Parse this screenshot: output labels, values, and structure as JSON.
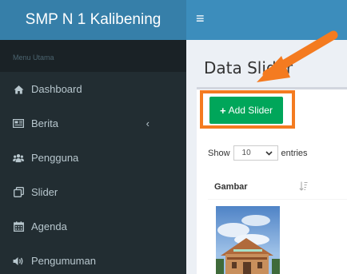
{
  "header": {
    "brand": "SMP N 1 Kalibening",
    "menu_icon": "≡"
  },
  "sidebar": {
    "section_label": "Menu Utama",
    "items": [
      {
        "label": "Dashboard",
        "icon": "home-icon"
      },
      {
        "label": "Berita",
        "icon": "newspaper-icon",
        "chevron": "‹"
      },
      {
        "label": "Pengguna",
        "icon": "users-icon"
      },
      {
        "label": "Slider",
        "icon": "copy-icon"
      },
      {
        "label": "Agenda",
        "icon": "calendar-icon"
      },
      {
        "label": "Pengumuman",
        "icon": "volume-icon"
      }
    ]
  },
  "main": {
    "title": "Data Slider",
    "add_button": {
      "plus": "+",
      "label": "Add Slider"
    },
    "length": {
      "show": "Show",
      "value": "10",
      "entries": "entries"
    },
    "table": {
      "header": "Gambar"
    }
  },
  "colors": {
    "header_brand": "#367fa9",
    "header_bar": "#3c8dbc",
    "sidebar": "#222d32",
    "button": "#00a65a",
    "highlight": "#f47b20"
  }
}
